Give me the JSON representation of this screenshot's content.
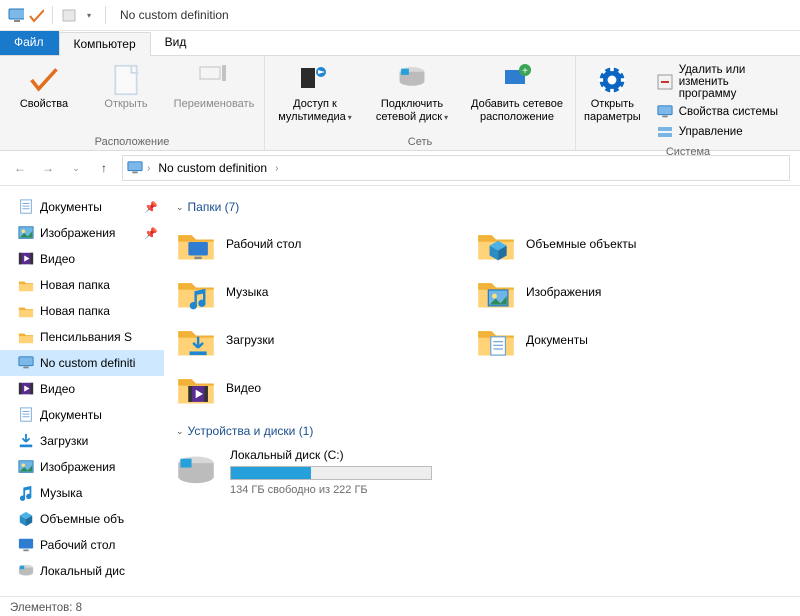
{
  "window": {
    "title": "No custom definition"
  },
  "tabs": {
    "file": "Файл",
    "computer": "Компьютер",
    "view": "Вид"
  },
  "ribbon": {
    "location": {
      "label": "Расположение",
      "properties": "Свойства",
      "open": "Открыть",
      "rename": "Переименовать"
    },
    "network": {
      "label": "Сеть",
      "media": "Доступ к\nмультимедиа",
      "mapdrive": "Подключить\nсетевой диск",
      "addloc": "Добавить сетевое\nрасположение"
    },
    "system": {
      "label": "Система",
      "params": "Открыть\nпараметры",
      "uninstall": "Удалить или изменить программу",
      "sysprops": "Свойства системы",
      "manage": "Управление"
    }
  },
  "breadcrumb": {
    "item": "No custom definition"
  },
  "tree": [
    {
      "label": "Документы",
      "icon": "documents",
      "pinned": true
    },
    {
      "label": "Изображения",
      "icon": "pictures",
      "pinned": true
    },
    {
      "label": "Видео",
      "icon": "video",
      "pinned": false
    },
    {
      "label": "Новая папка",
      "icon": "folder",
      "pinned": false
    },
    {
      "label": "Новая папка",
      "icon": "folder",
      "pinned": false
    },
    {
      "label": "Пенсильвания S",
      "icon": "folder",
      "pinned": false
    },
    {
      "label": "No custom definiti",
      "icon": "thispc",
      "pinned": false,
      "selected": true
    },
    {
      "label": "Видео",
      "icon": "video",
      "pinned": false
    },
    {
      "label": "Документы",
      "icon": "documents",
      "pinned": false
    },
    {
      "label": "Загрузки",
      "icon": "downloads",
      "pinned": false
    },
    {
      "label": "Изображения",
      "icon": "pictures",
      "pinned": false
    },
    {
      "label": "Музыка",
      "icon": "music",
      "pinned": false
    },
    {
      "label": "Объемные объ",
      "icon": "3d",
      "pinned": false
    },
    {
      "label": "Рабочий стол",
      "icon": "desktop",
      "pinned": false
    },
    {
      "label": "Локальный дис",
      "icon": "disk",
      "pinned": false
    }
  ],
  "groups": {
    "folders": {
      "header": "Папки (7)",
      "items": [
        {
          "label": "Рабочий стол",
          "icon": "desktop"
        },
        {
          "label": "Объемные объекты",
          "icon": "3d"
        },
        {
          "label": "Музыка",
          "icon": "music"
        },
        {
          "label": "Изображения",
          "icon": "pictures"
        },
        {
          "label": "Загрузки",
          "icon": "downloads"
        },
        {
          "label": "Документы",
          "icon": "documents"
        },
        {
          "label": "Видео",
          "icon": "video"
        }
      ]
    },
    "drives": {
      "header": "Устройства и диски (1)",
      "disk": {
        "name": "Локальный диск (C:)",
        "free": "134 ГБ свободно из 222 ГБ",
        "pct": 40
      }
    }
  },
  "status": {
    "count": "Элементов: 8"
  }
}
